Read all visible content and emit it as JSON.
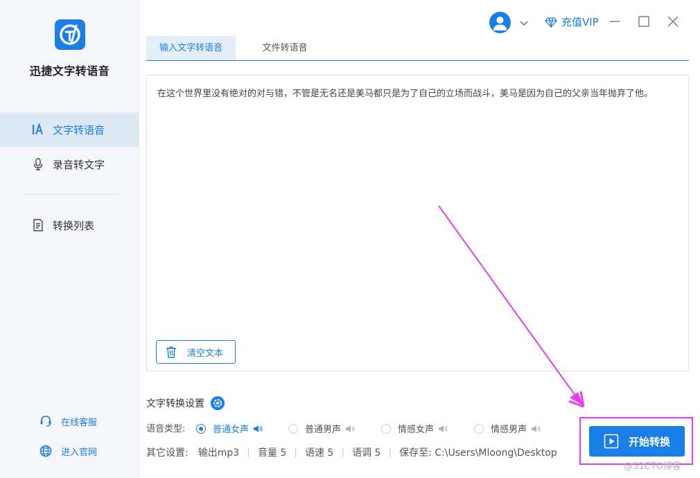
{
  "app": {
    "name": "迅捷文字转语音",
    "logo_icon": "tts-logo-icon",
    "accent_color": "#1a7ee8"
  },
  "sidebar": {
    "items": [
      {
        "label": "文字转语音",
        "icon": "text-to-speech-icon",
        "active": true
      },
      {
        "label": "录音转文字",
        "icon": "microphone-icon",
        "active": false
      },
      {
        "label": "转换列表",
        "icon": "list-document-icon",
        "active": false
      }
    ],
    "links": [
      {
        "label": "在线客服",
        "icon": "customer-service-icon"
      },
      {
        "label": "进入官网",
        "icon": "globe-icon"
      }
    ]
  },
  "titlebar": {
    "vip_label": "充值VIP",
    "avatar_icon": "user-avatar-icon"
  },
  "tabs": [
    {
      "label": "输入文字转语音",
      "active": true
    },
    {
      "label": "文件转语音",
      "active": false
    }
  ],
  "editor": {
    "text": "在这个世界里没有绝对的对与错，不管是无名还是美马都只是为了自己的立场而战斗，美马是因为自己的父亲当年抛弃了他。",
    "clear_label": "清空文本"
  },
  "settings": {
    "title": "文字转换设置",
    "voice_label": "语音类型:",
    "voices": [
      {
        "label": "普通女声",
        "selected": true
      },
      {
        "label": "普通男声",
        "selected": false
      },
      {
        "label": "情感女声",
        "selected": false
      },
      {
        "label": "情感男声",
        "selected": false
      }
    ],
    "other_label": "其它设置:",
    "output_format": "输出mp3",
    "volume": "音量 5",
    "speed": "语速 5",
    "pitch": "语调 5",
    "save_to": "保存至: C:\\Users\\Mloong\\Desktop"
  },
  "start_button": {
    "label": "开始转换"
  },
  "annotation": {
    "highlight_color": "#e93be8"
  },
  "watermark": "@51CTO博客"
}
